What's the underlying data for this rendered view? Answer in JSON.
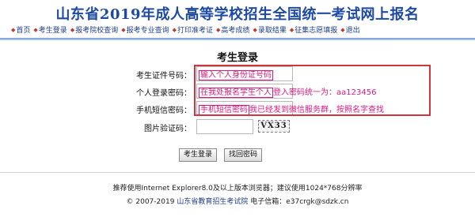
{
  "header": {
    "title": "山东省2019年成人高等学校招生全国统一考试网上报名",
    "nav": [
      {
        "label": "首页"
      },
      {
        "label": "考生登录"
      },
      {
        "label": "报考院校查询"
      },
      {
        "label": "报考专业查询"
      },
      {
        "label": "打印准考证"
      },
      {
        "label": "高考成绩"
      },
      {
        "label": "录取结果"
      },
      {
        "label": "征集志愿填报"
      },
      {
        "label": "退出"
      }
    ]
  },
  "login": {
    "title": "考生登录",
    "id_label": "考生证件号码：",
    "id_note": "输入个人身份证号码",
    "password_label": "个人登录密码：",
    "password_note_boxed": "在我处报名学生个人",
    "password_note_rest": "登入密码统一为：aa123456",
    "sms_label": "手机短信密码：",
    "sms_note_boxed": "手机短信密码",
    "sms_note_rest": "我已经发到微信服务群，按照名字查找",
    "captcha_label": "图片验证码：",
    "captcha_value": "",
    "captcha_image_text": "VX33",
    "login_button": "考生登录",
    "recover_button": "找回密码"
  },
  "footer": {
    "browser_note": "推荐使用Internet Explorer8.0及以上版本浏览器；建议使用1024*768分辨率",
    "copyright": "© 2007-2019",
    "org": "山东省教育招生考试院",
    "email": "电子信箱：e37crgk@sdzk.cn"
  },
  "colors": {
    "title": "#1e4aa3",
    "note": "#d8197d",
    "frame": "#d0343e"
  }
}
